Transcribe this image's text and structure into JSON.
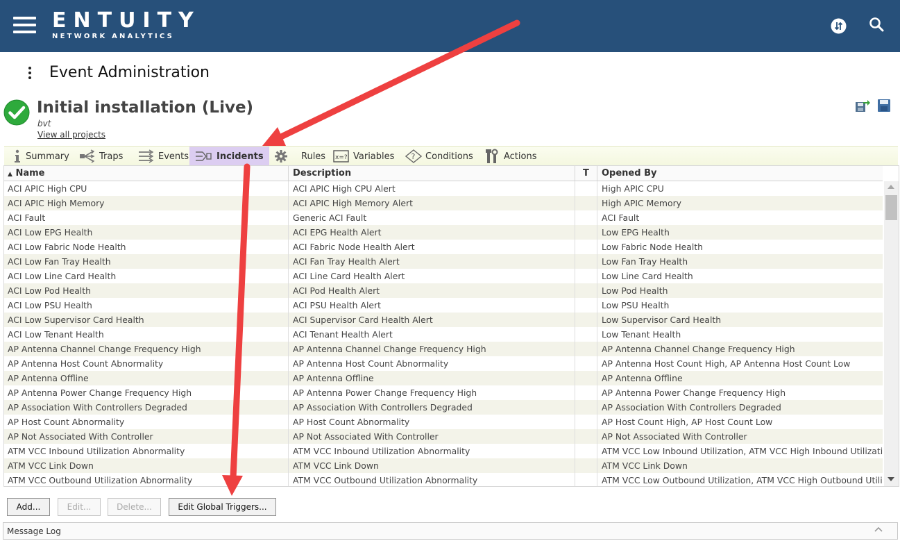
{
  "brand": {
    "name": "ENTUITY",
    "tagline": "NETWORK ANALYTICS"
  },
  "page": {
    "title": "Event Administration"
  },
  "project": {
    "title": "Initial installation (Live)",
    "subtitle": "bvt",
    "view_all_link": "View all projects"
  },
  "tabs": [
    {
      "label": "Summary",
      "icon": "info-icon",
      "active": false
    },
    {
      "label": "Traps",
      "icon": "traps-icon",
      "active": false
    },
    {
      "label": "Events",
      "icon": "events-icon",
      "active": false
    },
    {
      "label": "Incidents",
      "icon": "incidents-icon",
      "active": true
    },
    {
      "label": "Rules",
      "icon": "gear-icon",
      "active": false
    },
    {
      "label": "Variables",
      "icon": "variables-icon",
      "active": false
    },
    {
      "label": "Conditions",
      "icon": "conditions-icon",
      "active": false
    },
    {
      "label": "Actions",
      "icon": "tools-icon",
      "active": false
    }
  ],
  "grid": {
    "columns": {
      "name": "Name",
      "description": "Description",
      "t": "T",
      "opened_by": "Opened By"
    },
    "sort_indicator": "▲",
    "rows": [
      [
        "ACI APIC High CPU",
        "ACI APIC High CPU Alert",
        "",
        "High APIC CPU"
      ],
      [
        "ACI APIC High Memory",
        "ACI APIC High Memory Alert",
        "",
        "High APIC Memory"
      ],
      [
        "ACI Fault",
        "Generic ACI Fault",
        "",
        "ACI Fault"
      ],
      [
        "ACI Low EPG Health",
        "ACI EPG Health Alert",
        "",
        "Low EPG Health"
      ],
      [
        "ACI Low Fabric Node Health",
        "ACI Fabric Node Health Alert",
        "",
        "Low Fabric Node Health"
      ],
      [
        "ACI Low Fan Tray Health",
        "ACI Fan Tray Health Alert",
        "",
        "Low Fan Tray Health"
      ],
      [
        "ACI Low Line Card Health",
        "ACI Line Card Health Alert",
        "",
        "Low Line Card Health"
      ],
      [
        "ACI Low Pod Health",
        "ACI Pod Health Alert",
        "",
        "Low Pod Health"
      ],
      [
        "ACI Low PSU Health",
        "ACI PSU Health Alert",
        "",
        "Low PSU Health"
      ],
      [
        "ACI Low Supervisor Card Health",
        "ACI Supervisor Card Health Alert",
        "",
        "Low Supervisor Card Health"
      ],
      [
        "ACI Low Tenant Health",
        "ACI Tenant Health Alert",
        "",
        "Low Tenant Health"
      ],
      [
        "AP Antenna Channel Change Frequency High",
        "AP Antenna Channel Change Frequency High",
        "",
        "AP Antenna Channel Change Frequency High"
      ],
      [
        "AP Antenna Host Count Abnormality",
        "AP Antenna Host Count Abnormality",
        "",
        "AP Antenna Host Count High, AP Antenna Host Count Low"
      ],
      [
        "AP Antenna Offline",
        "AP Antenna Offline",
        "",
        "AP Antenna Offline"
      ],
      [
        "AP Antenna Power Change Frequency High",
        "AP Antenna Power Change Frequency High",
        "",
        "AP Antenna Power Change Frequency High"
      ],
      [
        "AP Association With Controllers Degraded",
        "AP Association With Controllers Degraded",
        "",
        "AP Association With Controllers Degraded"
      ],
      [
        "AP Host Count Abnormality",
        "AP Host Count Abnormality",
        "",
        "AP Host Count High, AP Host Count Low"
      ],
      [
        "AP Not Associated With Controller",
        "AP Not Associated With Controller",
        "",
        "AP Not Associated With Controller"
      ],
      [
        "ATM VCC Inbound Utilization Abnormality",
        "ATM VCC Inbound Utilization Abnormality",
        "",
        "ATM VCC Low Inbound Utilization, ATM VCC High Inbound Utilization"
      ],
      [
        "ATM VCC Link Down",
        "ATM VCC Link Down",
        "",
        "ATM VCC Link Down"
      ],
      [
        "ATM VCC Outbound Utilization Abnormality",
        "ATM VCC Outbound Utilization Abnormality",
        "",
        "ATM VCC Low Outbound Utilization, ATM VCC High Outbound Utilizat"
      ]
    ]
  },
  "buttons": {
    "add": "Add...",
    "edit": "Edit...",
    "delete": "Delete...",
    "edit_global_triggers": "Edit Global Triggers..."
  },
  "message_log": {
    "label": "Message Log"
  },
  "colors": {
    "header_bg": "#27507a",
    "active_tab": "#dccdf1",
    "annotation_arrow": "#ee4040",
    "check_green": "#2eaa3c"
  }
}
